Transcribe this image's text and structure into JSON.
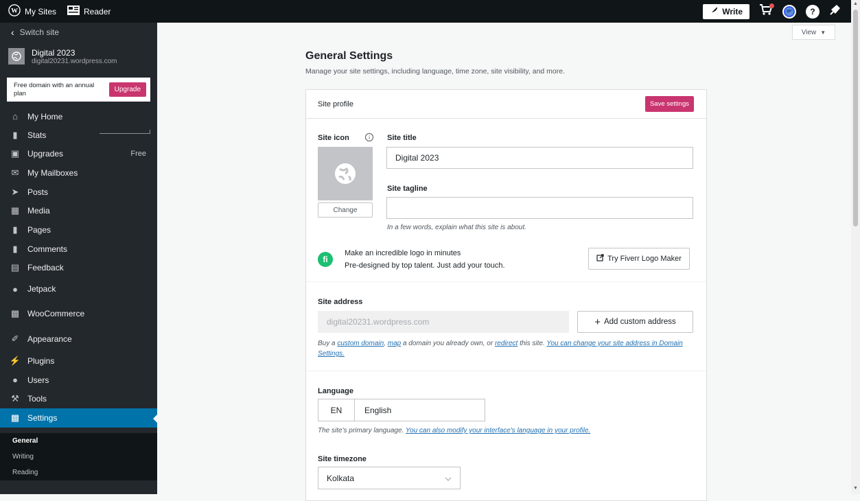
{
  "topbar": {
    "my_sites": "My Sites",
    "reader": "Reader",
    "write": "Write"
  },
  "sidebar": {
    "switch_site": "Switch site",
    "site_name": "Digital 2023",
    "site_url": "digital20231.wordpress.com",
    "upsell_text": "Free domain with an annual plan",
    "upsell_button": "Upgrade",
    "items": [
      {
        "label": "My Home",
        "icon": "home-icon"
      },
      {
        "label": "Stats",
        "icon": "stats-icon"
      },
      {
        "label": "Upgrades",
        "icon": "cart-icon",
        "badge": "Free"
      },
      {
        "label": "My Mailboxes",
        "icon": "mail-icon"
      },
      {
        "label": "Posts",
        "icon": "pin-icon"
      },
      {
        "label": "Media",
        "icon": "media-icon"
      },
      {
        "label": "Pages",
        "icon": "page-icon"
      },
      {
        "label": "Comments",
        "icon": "comment-icon"
      },
      {
        "label": "Feedback",
        "icon": "feedback-icon"
      },
      {
        "label": "Jetpack",
        "icon": "jetpack-icon"
      },
      {
        "label": "WooCommerce",
        "icon": "woo-icon"
      },
      {
        "label": "Appearance",
        "icon": "brush-icon"
      },
      {
        "label": "Plugins",
        "icon": "plug-icon"
      },
      {
        "label": "Users",
        "icon": "user-icon"
      },
      {
        "label": "Tools",
        "icon": "wrench-icon"
      },
      {
        "label": "Settings",
        "icon": "settings-icon"
      }
    ],
    "subitems": [
      "General",
      "Writing",
      "Reading"
    ]
  },
  "main": {
    "view_button": "View",
    "title": "General Settings",
    "subtitle": "Manage your site settings, including language, time zone, site visibility, and more.",
    "card": {
      "heading": "Site profile",
      "save_button": "Save settings",
      "site_icon_label": "Site icon",
      "change_button": "Change",
      "site_title_label": "Site title",
      "site_title_value": "Digital 2023",
      "site_tagline_label": "Site tagline",
      "site_tagline_value": "",
      "tagline_help": "In a few words, explain what this site is about.",
      "fiverr_title": "Make an incredible logo in minutes",
      "fiverr_sub": "Pre-designed by top talent. Just add your touch.",
      "fiverr_button": "Try Fiverr Logo Maker",
      "site_address_label": "Site address",
      "site_address_value": "digital20231.wordpress.com",
      "add_custom_address": "Add custom address",
      "address_help": {
        "t1": "Buy a ",
        "link_custom_domain": "custom domain",
        "t2": ", ",
        "link_map": "map",
        "t3": " a domain you already own, or ",
        "link_redirect": "redirect",
        "t4": " this site. ",
        "link_change": "You can change your site address in Domain Settings."
      },
      "language_label": "Language",
      "language_code": "EN",
      "language_value": "English",
      "language_help": "The site's primary language. ",
      "language_help_link": "You can also modify your interface's language in your profile.",
      "timezone_label": "Site timezone",
      "timezone_value": "Kolkata"
    }
  },
  "colors": {
    "accent": "#c9356e",
    "sidebar_bg": "#23282d",
    "active_blue": "#0073aa",
    "fiverr_green": "#1dbf73"
  }
}
